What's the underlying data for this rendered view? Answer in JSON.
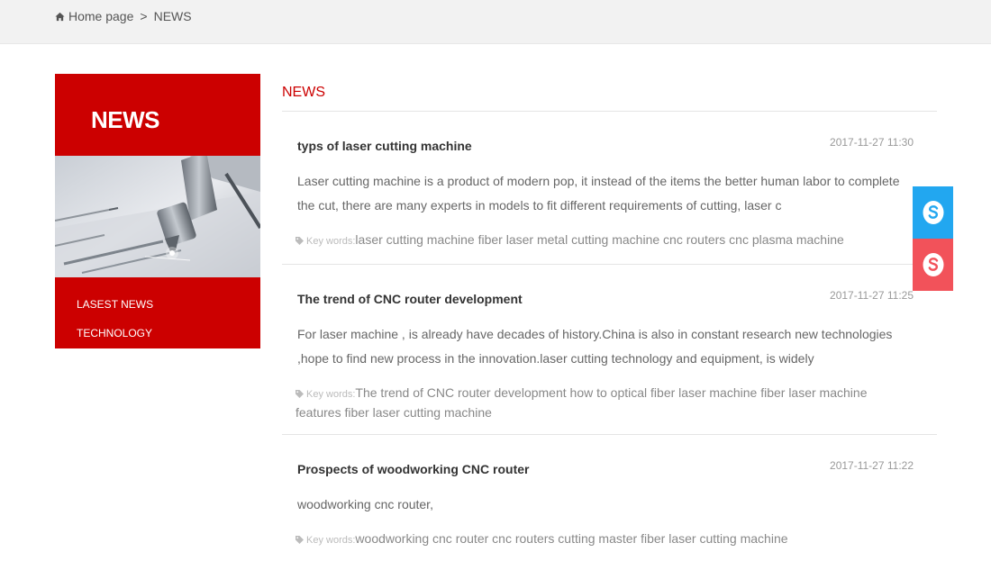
{
  "breadcrumb": {
    "home": "Home page",
    "separator": ">",
    "current": "NEWS"
  },
  "sidebar": {
    "title": "NEWS",
    "menu": [
      {
        "label": "LASEST NEWS"
      },
      {
        "label": "TECHNOLOGY"
      }
    ]
  },
  "main": {
    "title": "NEWS",
    "keywords_label": "Key words:",
    "items": [
      {
        "title": "typs of laser cutting machine",
        "date": "2017-11-27 11:30",
        "summary": "Laser cutting machine is a product of modern pop, it instead of the items the better human labor to complete the cut, there are many experts in models to fit different requirements of cutting, laser c",
        "keywords": "laser cutting machine fiber laser metal cutting machine cnc routers cnc plasma machine"
      },
      {
        "title": "The trend of CNC router development",
        "date": "2017-11-27 11:25",
        "summary": "For laser machine , is already have decades of history.China is also in constant research new technologies ,hope to find new process in the innovation.laser cutting technology and equipment, is widely",
        "keywords": "The trend of CNC router development how to optical fiber laser machine fiber laser machine features fiber laser cutting machine"
      },
      {
        "title": "Prospects of woodworking CNC router",
        "date": "2017-11-27 11:22",
        "summary": "woodworking cnc router,",
        "keywords": "woodworking cnc router cnc routers cutting master fiber laser cutting machine"
      }
    ]
  },
  "floating": [
    {
      "icon": "skype-icon",
      "color": "#22a7f0"
    },
    {
      "icon": "skype-icon",
      "color": "#f2525a"
    }
  ]
}
